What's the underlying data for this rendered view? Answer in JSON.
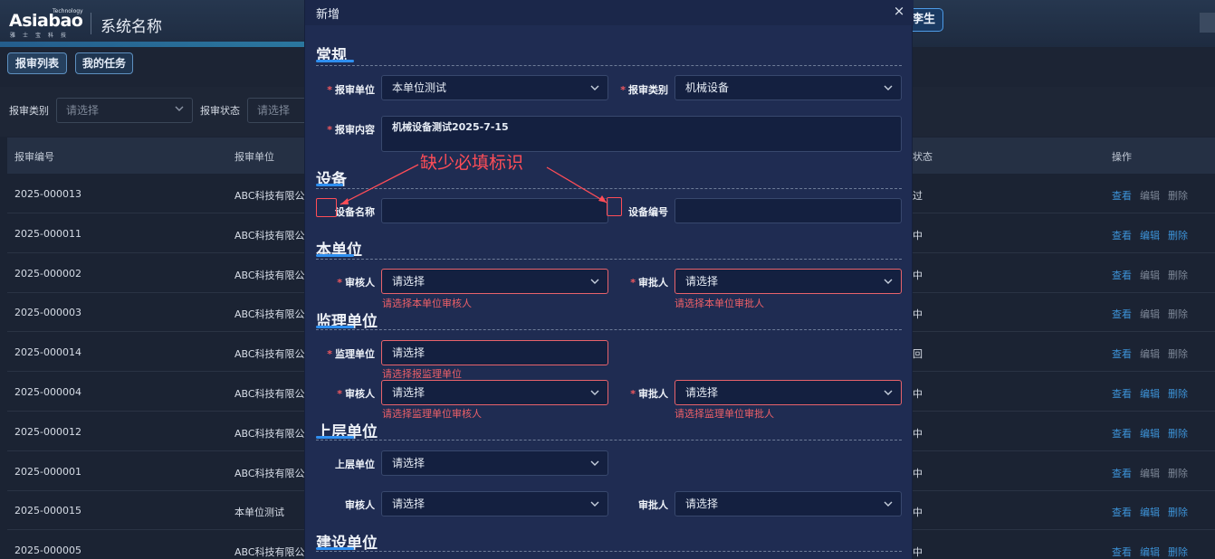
{
  "header": {
    "logo_word": "Asiabao",
    "logo_tech": "Technology",
    "logo_cn": "雅士宝科技",
    "system_title": "系统名称",
    "user_label": "李生"
  },
  "tabs": [
    {
      "label": "报审列表"
    },
    {
      "label": "我的任务"
    }
  ],
  "filters": {
    "category_label": "报审类别",
    "category_placeholder": "请选择",
    "status_label": "报审状态",
    "status_placeholder": "请选择"
  },
  "table": {
    "columns": [
      "报审编号",
      "报审单位",
      "状态",
      "操作"
    ],
    "actions": {
      "view": "查看",
      "edit": "编辑",
      "delete": "删除"
    },
    "rows": [
      {
        "id": "2025-000013",
        "unit": "ABC科技有限公",
        "status": "过"
      },
      {
        "id": "2025-000011",
        "unit": "ABC科技有限公",
        "status": "中"
      },
      {
        "id": "2025-000002",
        "unit": "ABC科技有限公",
        "status": "中"
      },
      {
        "id": "2025-000003",
        "unit": "ABC科技有限公",
        "status": "中"
      },
      {
        "id": "2025-000014",
        "unit": "ABC科技有限公",
        "status": "回"
      },
      {
        "id": "2025-000004",
        "unit": "ABC科技有限公",
        "status": "中"
      },
      {
        "id": "2025-000012",
        "unit": "ABC科技有限公",
        "status": "中"
      },
      {
        "id": "2025-000001",
        "unit": "ABC科技有限公",
        "status": "中"
      },
      {
        "id": "2025-000015",
        "unit": "本单位测试",
        "status": "中"
      },
      {
        "id": "2025-000005",
        "unit": "ABC科技有限公",
        "status": "中"
      }
    ]
  },
  "modal": {
    "title": "新增",
    "close": "×",
    "sections": {
      "general": "常规",
      "equipment": "设备",
      "own_unit": "本单位",
      "supervision": "监理单位",
      "upper": "上层单位",
      "construction": "建设单位"
    },
    "general": {
      "unit_label": "报审单位",
      "unit_value": "本单位测试",
      "category_label": "报审类别",
      "category_value": "机械设备",
      "content_label": "报审内容",
      "content_value": "机械设备测试2025-7-15"
    },
    "equipment": {
      "name_label": "设备名称",
      "name_value": "",
      "code_label": "设备编号",
      "code_value": ""
    },
    "own_unit": {
      "reviewer_label": "审核人",
      "reviewer_placeholder": "请选择",
      "reviewer_error": "请选择本单位审核人",
      "approver_label": "审批人",
      "approver_placeholder": "请选择",
      "approver_error": "请选择本单位审批人"
    },
    "supervision": {
      "unit_label": "监理单位",
      "unit_placeholder": "请选择",
      "unit_error": "请选择报监理单位",
      "reviewer_label": "审核人",
      "reviewer_placeholder": "请选择",
      "reviewer_error": "请选择监理单位审核人",
      "approver_label": "审批人",
      "approver_placeholder": "请选择",
      "approver_error": "请选择监理单位审批人"
    },
    "upper": {
      "unit_label": "上层单位",
      "unit_placeholder": "请选择",
      "reviewer_label": "审核人",
      "reviewer_placeholder": "请选择",
      "approver_label": "审批人",
      "approver_placeholder": "请选择"
    }
  },
  "annotation": {
    "text": "缺少必填标识"
  }
}
